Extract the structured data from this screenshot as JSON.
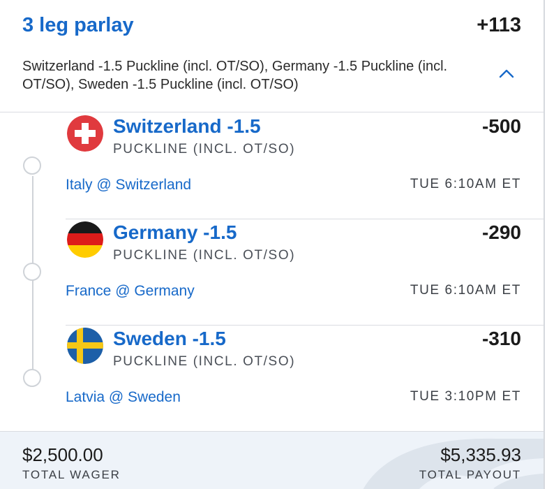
{
  "header": {
    "title": "3 leg parlay",
    "total_odds": "+113",
    "summary": "Switzerland -1.5 Puckline (incl. OT/SO), Germany -1.5 Puckline (incl. OT/SO), Sweden -1.5 Puckline (incl. OT/SO)",
    "chevron_icon": "chevron-up-icon"
  },
  "legs": [
    {
      "team": "Switzerland -1.5",
      "market": "PUCKLINE (INCL. OT/SO)",
      "odds": "-500",
      "event": "Italy @ Switzerland",
      "time": "TUE 6:10AM ET",
      "flag_icon": "switzerland-flag-icon"
    },
    {
      "team": "Germany -1.5",
      "market": "PUCKLINE (INCL. OT/SO)",
      "odds": "-290",
      "event": "France @ Germany",
      "time": "TUE 6:10AM ET",
      "flag_icon": "germany-flag-icon"
    },
    {
      "team": "Sweden -1.5",
      "market": "PUCKLINE (INCL. OT/SO)",
      "odds": "-310",
      "event": "Latvia @ Sweden",
      "time": "TUE 3:10PM ET",
      "flag_icon": "sweden-flag-icon"
    }
  ],
  "footer": {
    "wager_amount": "$2,500.00",
    "wager_label": "TOTAL WAGER",
    "payout_amount": "$5,335.93",
    "payout_label": "TOTAL PAYOUT"
  },
  "colors": {
    "accent": "#1769c9",
    "footer_bg": "#eef3f9",
    "divider": "#d9dce1"
  }
}
